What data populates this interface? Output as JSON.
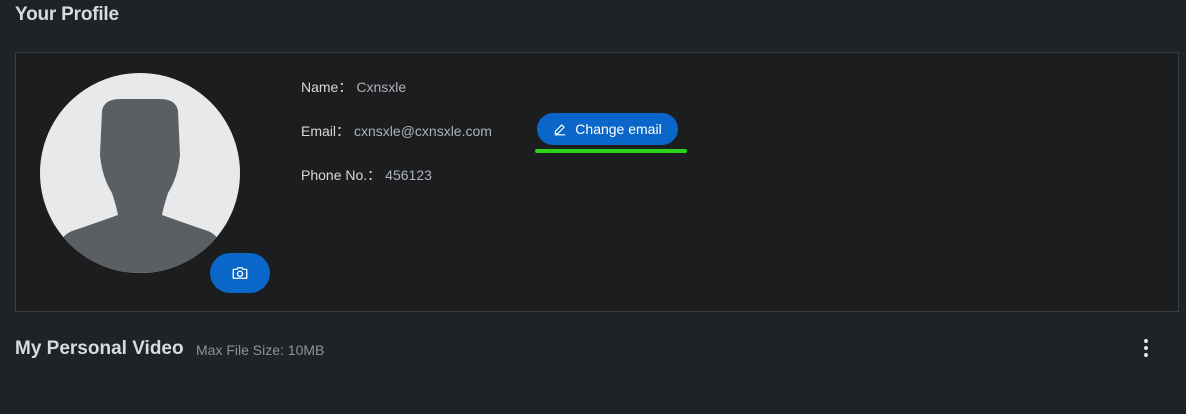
{
  "profile": {
    "section_title": "Your Profile",
    "name_label": "Name：",
    "name_value": "Cxnsxle",
    "email_label": "Email：",
    "email_value": "cxnsxle@cxnsxle.com",
    "phone_label": "Phone No.：",
    "phone_value": "456123",
    "change_email_label": "Change email",
    "camera_icon": "camera-icon",
    "edit_icon": "pencil-icon"
  },
  "video": {
    "section_title": "My Personal Video",
    "max_size_text": "Max File Size: 10MB",
    "more_icon": "more-vertical-icon"
  },
  "colors": {
    "accent": "#0a66c8",
    "highlight": "#2bd41a",
    "background": "#202325"
  }
}
